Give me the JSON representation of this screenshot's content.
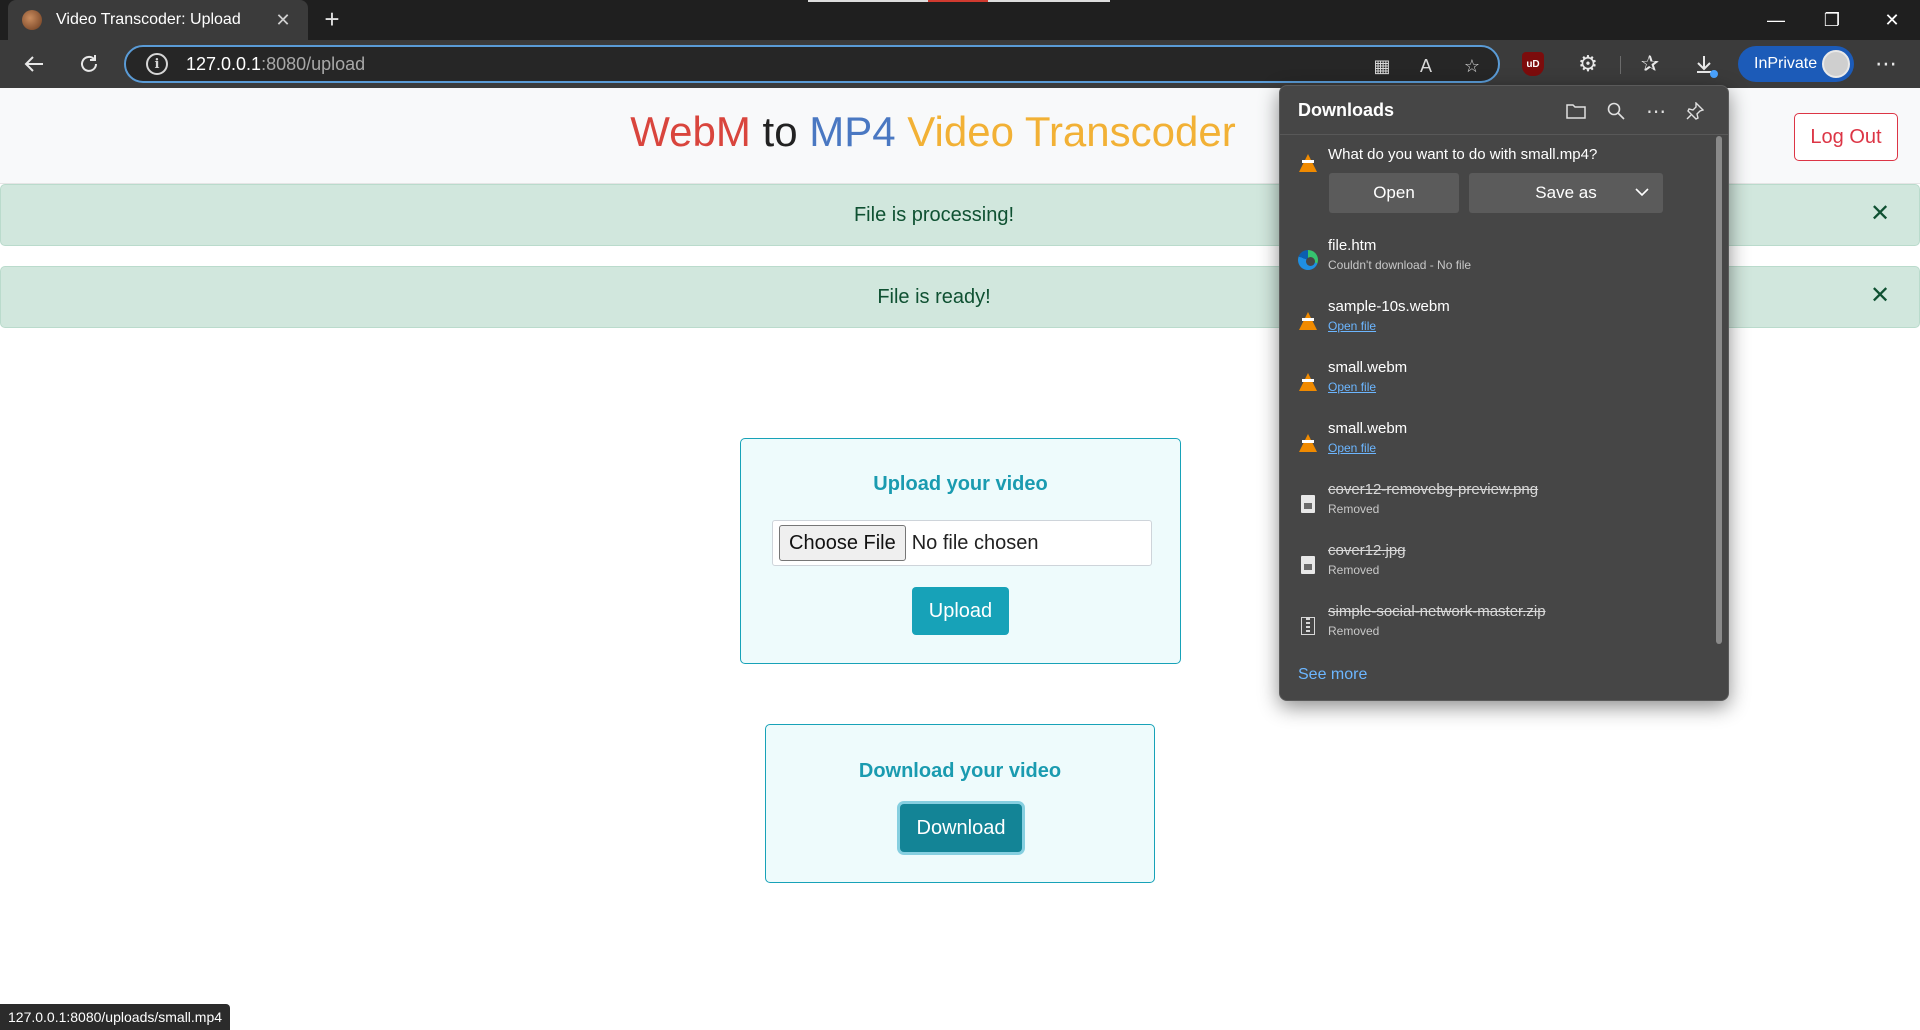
{
  "browser": {
    "tab_title": "Video Transcoder: Upload",
    "tab_close": "✕",
    "new_tab": "+",
    "url_host": "127.0.0.1",
    "url_rest": ":8080/upload",
    "inprivate_label": "InPrivate",
    "window_controls": {
      "minimize": "—",
      "maximize": "❐",
      "close": "✕"
    }
  },
  "page": {
    "brand": {
      "word1": "WebM",
      "word2": "to",
      "word3": "MP4",
      "word4": "Video Transcoder"
    },
    "logout_label": "Log Out",
    "alerts": [
      {
        "text": "File is processing!",
        "close": "✕"
      },
      {
        "text": "File is ready!",
        "close": "✕"
      }
    ],
    "upload_card": {
      "title": "Upload your video",
      "choose_file": "Choose File",
      "no_file": "No file chosen",
      "button": "Upload"
    },
    "download_card": {
      "title": "Download your video",
      "button": "Download"
    },
    "status_url": "127.0.0.1:8080/uploads/small.mp4"
  },
  "downloads": {
    "title": "Downloads",
    "prompt": "What do you want to do with small.mp4?",
    "open_label": "Open",
    "save_as_label": "Save as",
    "items": [
      {
        "name": "file.htm",
        "status": "Couldn't download - No file"
      },
      {
        "name": "sample-10s.webm",
        "status": "Open file"
      },
      {
        "name": "small.webm",
        "status": "Open file"
      },
      {
        "name": "small.webm",
        "status": "Open file"
      },
      {
        "name": "cover12-removebg-preview.png",
        "status": "Removed"
      },
      {
        "name": "cover12.jpg",
        "status": "Removed"
      },
      {
        "name": "simple-social-network-master.zip",
        "status": "Removed"
      }
    ],
    "see_more": "See more"
  },
  "colors": {
    "brand_red": "#d9453d",
    "brand_blue": "#4a78c2",
    "brand_yellow": "#f2b135",
    "brand_dark": "#222222",
    "info": "#17a2b8",
    "danger": "#dc3545",
    "alert_bg": "#d1e7dd"
  }
}
